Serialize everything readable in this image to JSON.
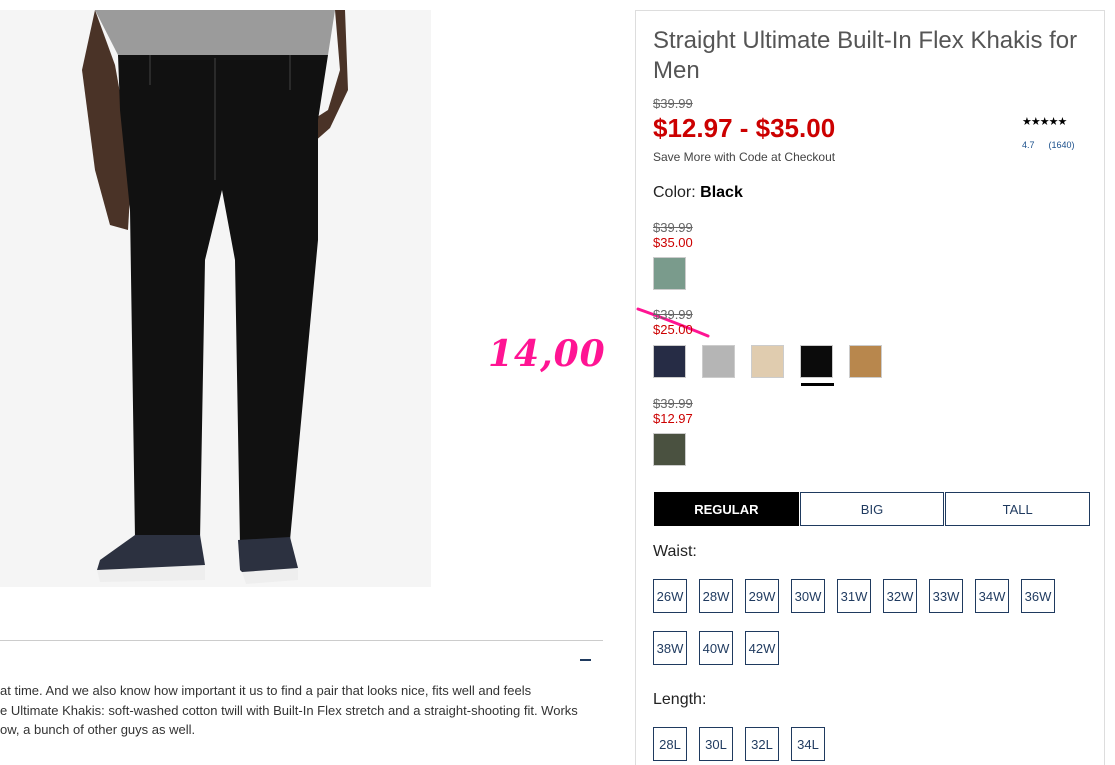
{
  "product": {
    "title": "Straight Ultimate Built-In Flex Khakis for Men",
    "original_price": "$39.99",
    "sale_price": "$12.97 - $35.00",
    "save_note": "Save More with Code at Checkout",
    "rating": {
      "stars": "★★★★★",
      "score": "4.7",
      "count": "(1640)"
    }
  },
  "color": {
    "label": "Color:",
    "selected": "Black",
    "groups": [
      {
        "was": "$39.99",
        "now": "$35.00",
        "swatches": [
          {
            "name": "sage",
            "hex": "#7a9b8c"
          }
        ]
      },
      {
        "was": "$39.99",
        "now": "$25.00",
        "swatches": [
          {
            "name": "navy",
            "hex": "#262c45"
          },
          {
            "name": "heather-gray",
            "hex": "#b5b5b5"
          },
          {
            "name": "khaki",
            "hex": "#e0ccaf"
          },
          {
            "name": "black",
            "hex": "#0b0b0b",
            "selected": true
          },
          {
            "name": "tan",
            "hex": "#b8874d"
          }
        ]
      },
      {
        "was": "$39.99",
        "now": "$12.97",
        "swatches": [
          {
            "name": "olive",
            "hex": "#4a5140"
          }
        ]
      }
    ]
  },
  "fit_tabs": [
    "REGULAR",
    "BIG",
    "TALL"
  ],
  "waist": {
    "label": "Waist:",
    "sizes": [
      "26W",
      "28W",
      "29W",
      "30W",
      "31W",
      "32W",
      "33W",
      "34W",
      "36W",
      "38W",
      "40W",
      "42W"
    ]
  },
  "length": {
    "label": "Length:",
    "sizes": [
      "28L",
      "30L",
      "32L",
      "34L"
    ]
  },
  "description": {
    "lines": [
      "at time. And we also know how important it us to find a pair that looks nice, fits well and feels",
      "e Ultimate Khakis: soft-washed cotton twill with Built-In Flex stretch and a straight-shooting fit. Works",
      "ow, a bunch of other guys as well."
    ]
  },
  "annotation": {
    "handwritten_price": "14,00",
    "ink_color": "#ff1493"
  },
  "colors": {
    "sale_red": "#cc0000",
    "navy_border": "#1f3a5f"
  }
}
